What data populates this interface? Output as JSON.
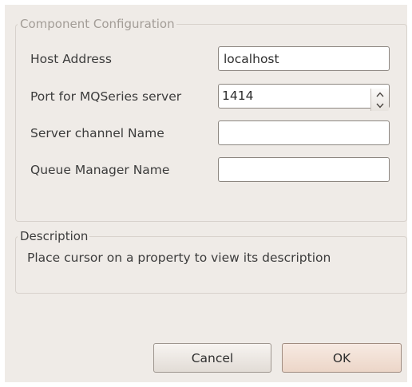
{
  "config": {
    "legend": "Component Configuration",
    "fields": [
      {
        "label": "Host Address",
        "value": "localhost"
      },
      {
        "label": "Port for MQSeries server",
        "value": "1414"
      },
      {
        "label": "Server channel Name",
        "value": ""
      },
      {
        "label": "Queue Manager Name",
        "value": ""
      }
    ]
  },
  "description": {
    "legend": "Description",
    "text": "Place cursor on a property to view its description"
  },
  "buttons": {
    "cancel": "Cancel",
    "ok": "OK"
  }
}
